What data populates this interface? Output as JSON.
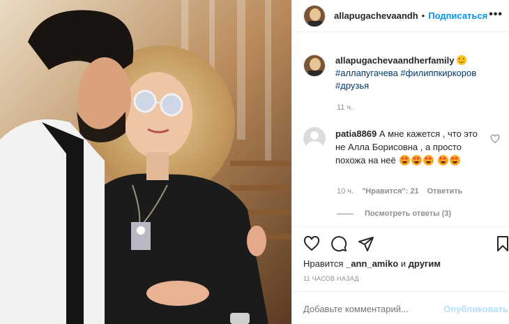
{
  "post": {
    "username": "allapugachevaandh",
    "follow_label": "Подписаться",
    "dot": "•",
    "more_label": "•••"
  },
  "caption": {
    "username": "allapugachevaandherfamily",
    "hashtags": [
      "#аллапугачева",
      "#филиппкиркоров",
      "#друзья"
    ],
    "time": "11 ч."
  },
  "comment": {
    "username": "patia8869",
    "text": "А мне кажется , что это не Алла Борисовна , а просто похожа на неё",
    "emoji_count": 5,
    "time": "10 ч.",
    "likes": "\"Нравится\": 21",
    "reply_label": "Ответить",
    "view_replies": "Посмотреть ответы (3)"
  },
  "likes": {
    "prefix": "Нравится",
    "user": "_ann_amiko",
    "joiner": "и",
    "others": "другим"
  },
  "post_time": "11 ЧАСОВ НАЗАД",
  "add_comment": {
    "placeholder": "Добавьте комментарий...",
    "publish_label": "Опубликовать"
  },
  "icons": {
    "like": "heart-icon",
    "comment": "comment-bubble-icon",
    "share": "paper-plane-icon",
    "save": "bookmark-icon",
    "comment_like": "heart-icon"
  },
  "colors": {
    "link_blue": "#0095f6",
    "hashtag": "#00376b",
    "muted": "#8e8e8e",
    "publish_disabled": "#b2dffc"
  }
}
